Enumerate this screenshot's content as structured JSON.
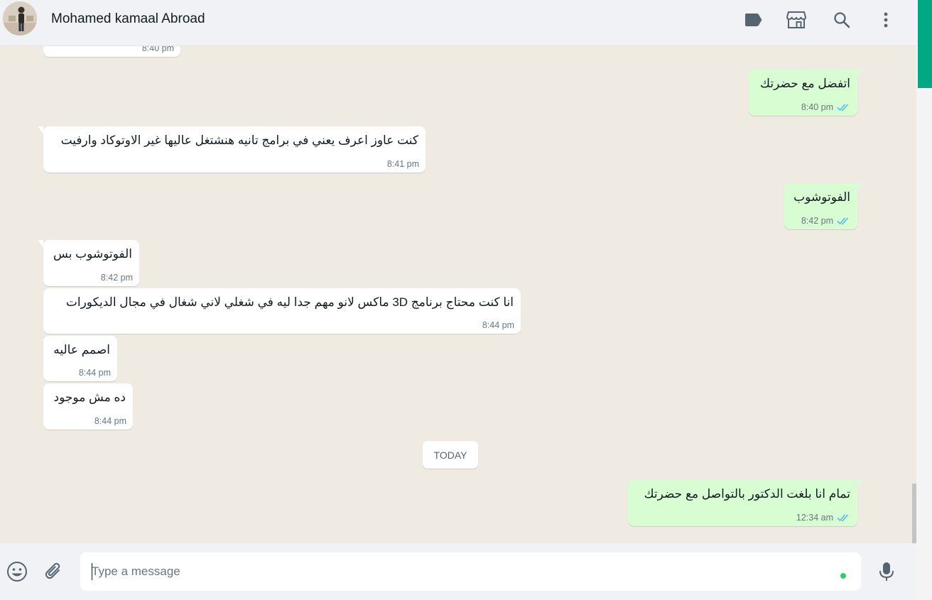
{
  "header": {
    "contact_name": "Mohamed kamaal Abroad",
    "icons": [
      "label-icon",
      "store-icon",
      "search-icon",
      "menu-icon"
    ]
  },
  "chat": {
    "date_divider": "TODAY",
    "messages": [
      {
        "dir": "in",
        "text": "",
        "time": "8:40 pm"
      },
      {
        "dir": "out",
        "text": "اتفضل مع حضرتك",
        "time": "8:40 pm",
        "status": "read"
      },
      {
        "dir": "in",
        "text": "كنت عاوز اعرف يعني في برامج تانيه هنشتغل عاليها غير الاوتوكاد وارفيت",
        "time": "8:41 pm"
      },
      {
        "dir": "out",
        "text": "الفوتوشوب",
        "time": "8:42 pm",
        "status": "read"
      },
      {
        "dir": "in",
        "text": "الفوتوشوب بس",
        "time": "8:42 pm"
      },
      {
        "dir": "in",
        "text": "انا كنت محتاج برنامج 3D  ماكس لانو مهم جدا ليه في شغلي لاني شغال في مجال الديكورات",
        "time": "8:44 pm"
      },
      {
        "dir": "in",
        "text": "اصمم عاليه",
        "time": "8:44 pm"
      },
      {
        "dir": "in",
        "text": "ده مش موجود",
        "time": "8:44 pm"
      },
      {
        "dir": "out",
        "text": "تمام انا بلغت الدكتور بالتواصل مع حضرتك",
        "time": "12:34 am",
        "status": "read"
      }
    ]
  },
  "footer": {
    "placeholder": "Type a message",
    "icons": [
      "emoji-icon",
      "attach-icon",
      "microphone-icon"
    ]
  },
  "colors": {
    "accent": "#00a884",
    "outgoing_bubble": "#d9fdd3",
    "incoming_bubble": "#ffffff",
    "chat_background": "#efeae2",
    "read_ticks": "#53bdeb"
  }
}
